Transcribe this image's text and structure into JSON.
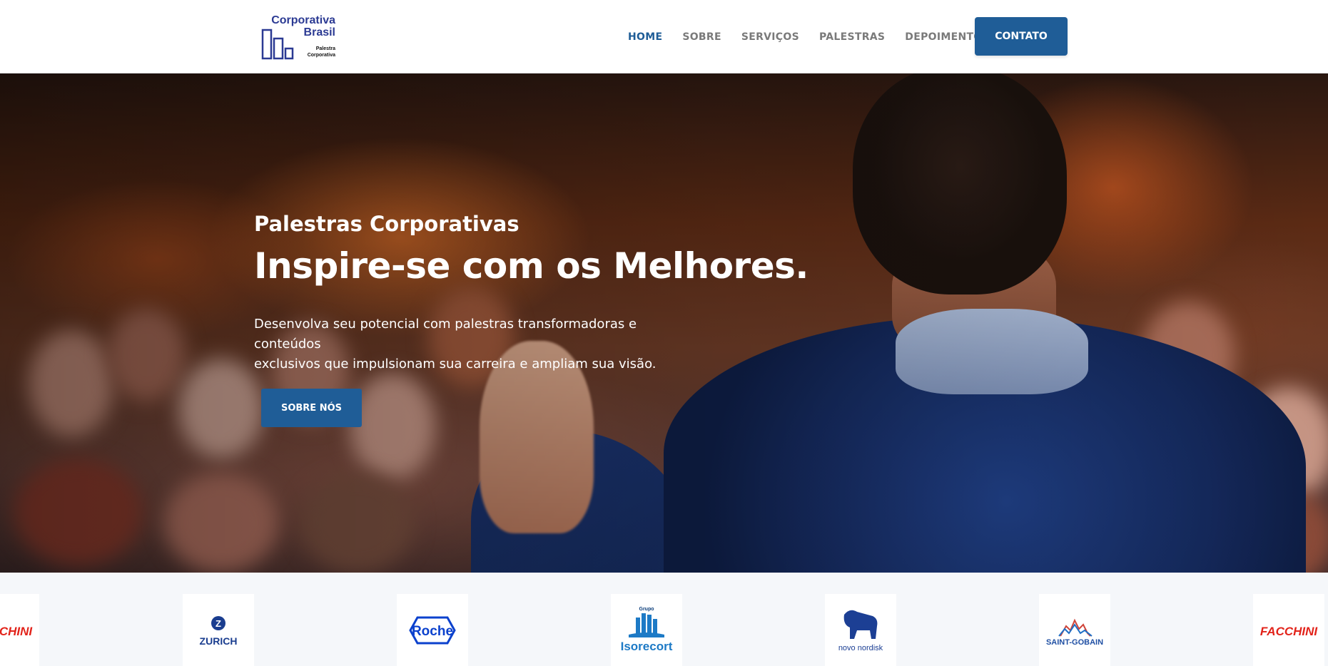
{
  "brand": {
    "name_line1": "Corporativa",
    "name_line2": "Brasil",
    "tagline_line1": "Palestra",
    "tagline_line2": "Corporativa",
    "color": "#2b3a93"
  },
  "nav": {
    "items": [
      {
        "label": "HOME",
        "active": true
      },
      {
        "label": "SOBRE",
        "active": false
      },
      {
        "label": "SERVIÇOS",
        "active": false
      },
      {
        "label": "PALESTRAS",
        "active": false
      },
      {
        "label": "DEPOIMENTOS",
        "active": false
      }
    ],
    "cta_label": "CONTATO",
    "accent_color": "#1f5d97"
  },
  "hero": {
    "eyebrow": "Palestras Corporativas",
    "title": "Inspire-se com os Melhores.",
    "description_line1": "Desenvolva seu potencial com palestras transformadoras e conteúdos",
    "description_line2": "exclusivos que impulsionam sua carreira e ampliam sua visão.",
    "button_label": "SOBRE NÓS",
    "background_image": "speaker-on-stage-photo"
  },
  "clients": {
    "logos": [
      {
        "name": "FACCHINI",
        "icon": "facchini-logo",
        "partial": true
      },
      {
        "name": "ZURICH",
        "icon": "zurich-logo"
      },
      {
        "name": "Roche",
        "icon": "roche-logo"
      },
      {
        "name": "Isorecort",
        "prefix": "Grupo",
        "icon": "isorecort-logo"
      },
      {
        "name": "novo nordisk",
        "icon": "novo-nordisk-logo"
      },
      {
        "name": "SAINT-GOBAIN",
        "icon": "saint-gobain-logo"
      },
      {
        "name": "FACCHINI",
        "icon": "facchini-logo"
      }
    ]
  }
}
